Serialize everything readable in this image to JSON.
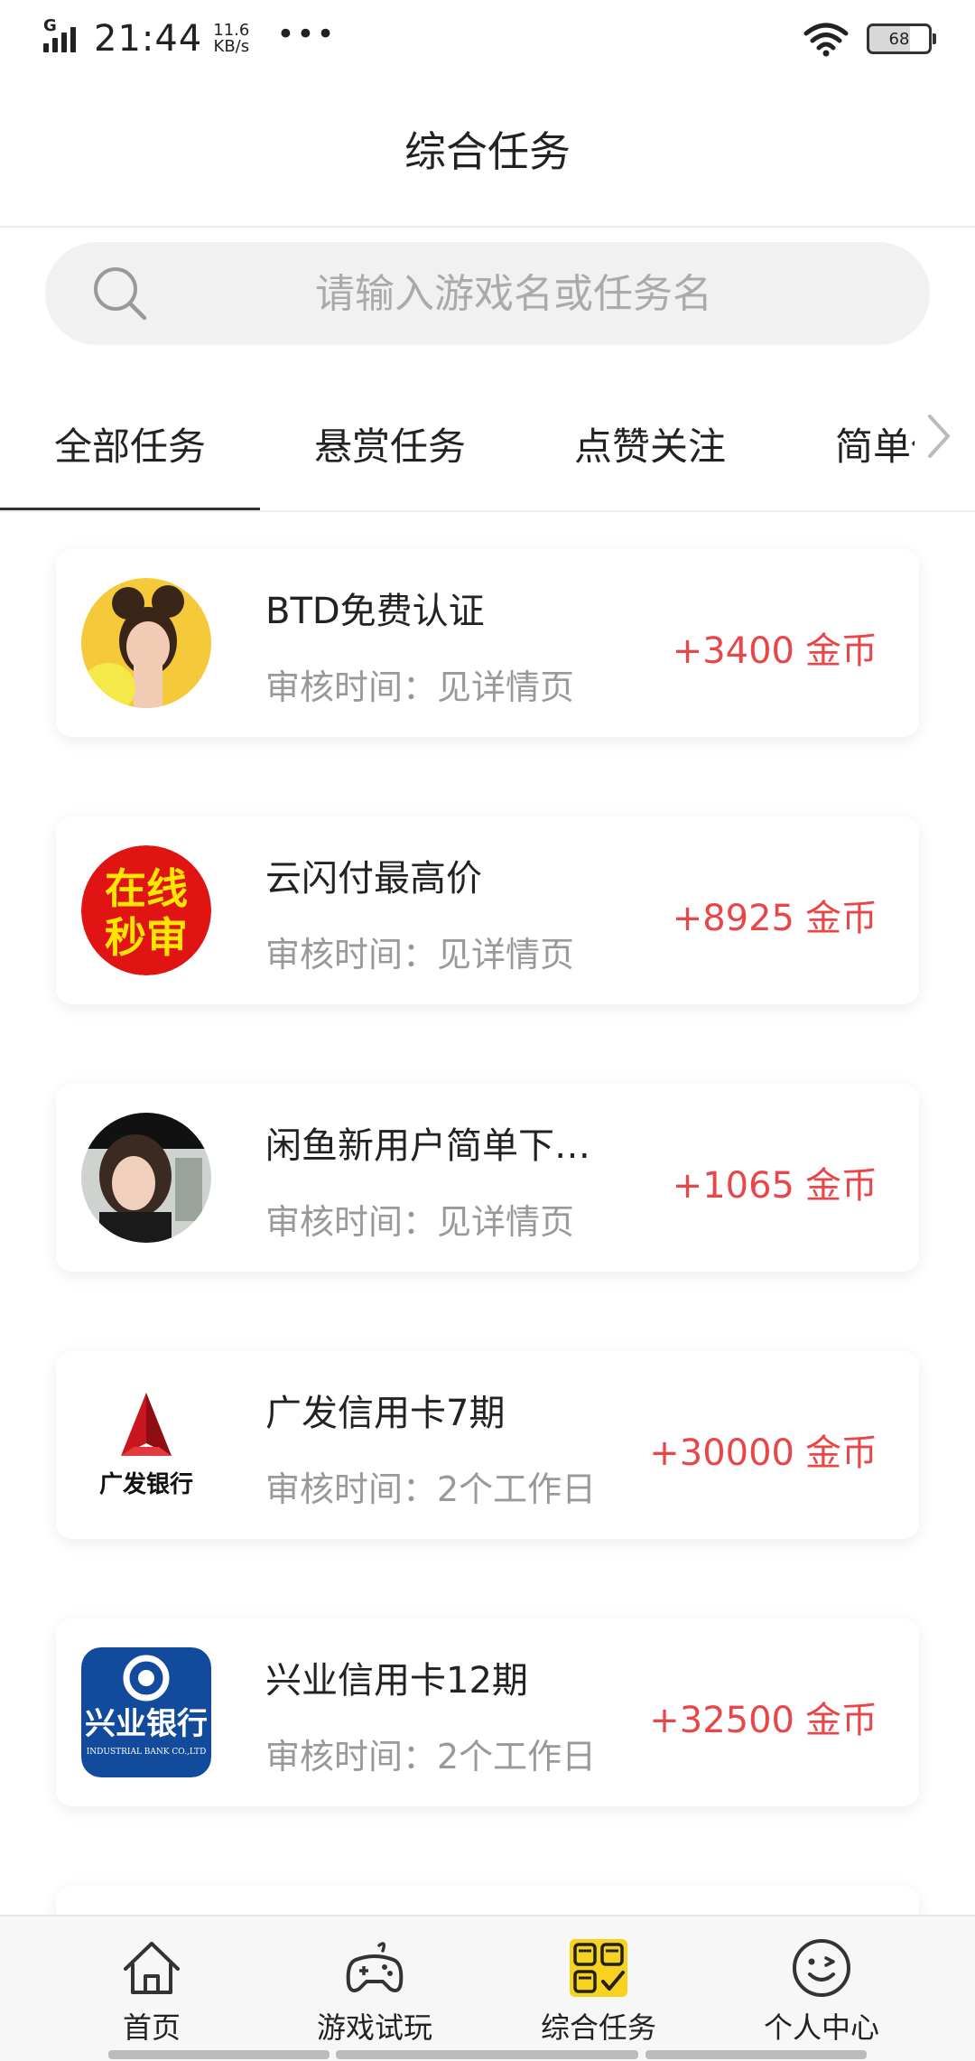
{
  "status_bar": {
    "network": "G",
    "time": "21:44",
    "speed_value": "11.6",
    "speed_unit": "KB/s",
    "more": "•••",
    "battery": "68"
  },
  "header": {
    "title": "综合任务"
  },
  "search": {
    "placeholder": "请输入游戏名或任务名"
  },
  "tabs": [
    {
      "label": "全部任务",
      "active": true
    },
    {
      "label": "悬赏任务",
      "active": false
    },
    {
      "label": "点赞关注",
      "active": false
    },
    {
      "label": "简单任务",
      "active": false
    }
  ],
  "tasks": [
    {
      "name": "BTD免费认证",
      "review": "审核时间：见详情页",
      "reward": "+3400",
      "unit": "金币",
      "icon": "girl-photo-avatar"
    },
    {
      "name": "云闪付最高价",
      "review": "审核时间：见详情页",
      "reward": "+8925",
      "unit": "金币",
      "icon": "online-review-logo",
      "logo_text": [
        "在线",
        "秒审"
      ]
    },
    {
      "name": "闲鱼新用户简单下…",
      "review": "审核时间：见详情页",
      "reward": "+1065",
      "unit": "金币",
      "icon": "woman-photo-avatar"
    },
    {
      "name": "广发信用卡7期",
      "review": "审核时间：2个工作日",
      "reward": "+30000",
      "unit": "金币",
      "icon": "cgb-bank-logo",
      "logo_text": "广发银行"
    },
    {
      "name": "兴业信用卡12期",
      "review": "审核时间：2个工作日",
      "reward": "+32500",
      "unit": "金币",
      "icon": "industrial-bank-logo",
      "logo_text": "兴业银行",
      "logo_subtext": "INDUSTRIAL BANK CO.,LTD"
    }
  ],
  "bottom_nav": [
    {
      "label": "首页",
      "icon": "home-icon",
      "active": false
    },
    {
      "label": "游戏试玩",
      "icon": "gamepad-icon",
      "active": false
    },
    {
      "label": "综合任务",
      "icon": "tasks-grid-icon",
      "active": true
    },
    {
      "label": "个人中心",
      "icon": "smiley-face-icon",
      "active": false
    }
  ],
  "colors": {
    "reward": "#e8474a",
    "accent_yellow": "#f7d21e",
    "text_primary": "#222222",
    "text_secondary": "#999999"
  }
}
